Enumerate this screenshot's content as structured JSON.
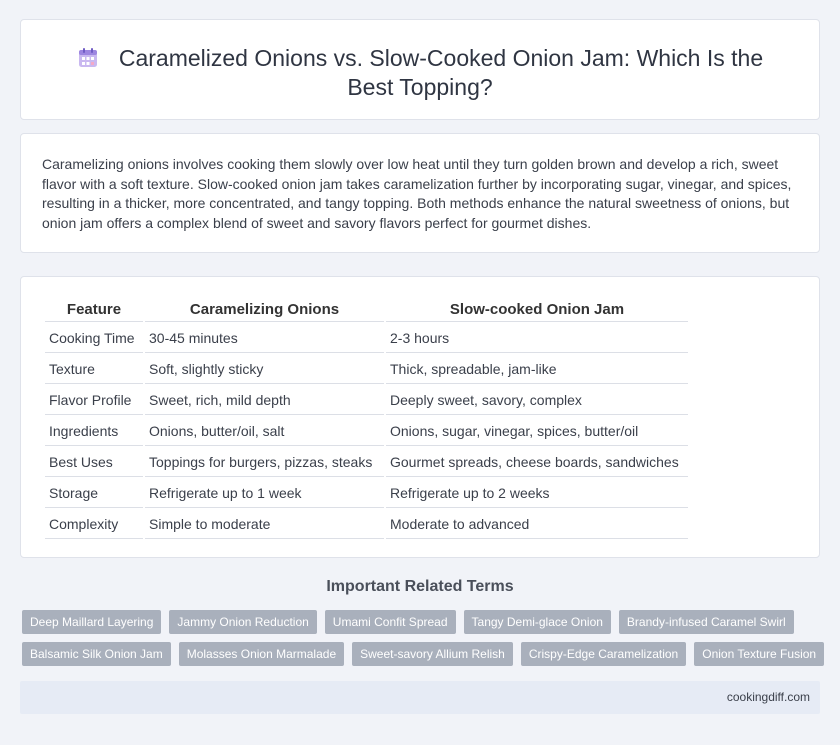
{
  "header": {
    "title": "Caramelized Onions vs. Slow-Cooked Onion Jam: Which Is the Best Topping?",
    "icon": "calendar-icon"
  },
  "intro": {
    "text": "Caramelizing onions involves cooking them slowly over low heat until they turn golden brown and develop a rich, sweet flavor with a soft texture. Slow-cooked onion jam takes caramelization further by incorporating sugar, vinegar, and spices, resulting in a thicker, more concentrated, and tangy topping. Both methods enhance the natural sweetness of onions, but onion jam offers a complex blend of sweet and savory flavors perfect for gourmet dishes."
  },
  "table": {
    "headers": [
      "Feature",
      "Caramelizing Onions",
      "Slow-cooked Onion Jam"
    ],
    "rows": [
      [
        "Cooking Time",
        "30-45 minutes",
        "2-3 hours"
      ],
      [
        "Texture",
        "Soft, slightly sticky",
        "Thick, spreadable, jam-like"
      ],
      [
        "Flavor Profile",
        "Sweet, rich, mild depth",
        "Deeply sweet, savory, complex"
      ],
      [
        "Ingredients",
        "Onions, butter/oil, salt",
        "Onions, sugar, vinegar, spices, butter/oil"
      ],
      [
        "Best Uses",
        "Toppings for burgers, pizzas, steaks",
        "Gourmet spreads, cheese boards, sandwiches"
      ],
      [
        "Storage",
        "Refrigerate up to 1 week",
        "Refrigerate up to 2 weeks"
      ],
      [
        "Complexity",
        "Simple to moderate",
        "Moderate to advanced"
      ]
    ]
  },
  "related": {
    "title": "Important Related Terms",
    "row1": [
      "Deep Maillard Layering",
      "Jammy Onion Reduction",
      "Umami Confit Spread",
      "Tangy Demi-glace Onion",
      "Brandy-infused Caramel Swirl"
    ],
    "row2": [
      "Balsamic Silk Onion Jam",
      "Molasses Onion Marmalade",
      "Sweet-savory Allium Relish",
      "Crispy-Edge Caramelization",
      "Onion Texture Fusion"
    ]
  },
  "footer": {
    "site": "cookingdiff.com"
  }
}
